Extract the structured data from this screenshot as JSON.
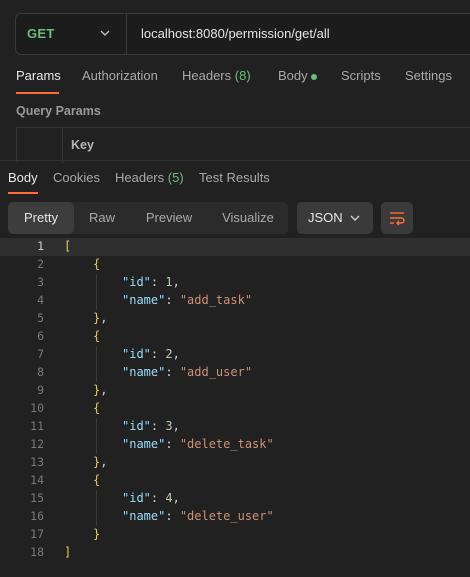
{
  "request": {
    "method": "GET",
    "url": "localhost:8080/permission/get/all"
  },
  "request_tabs": [
    {
      "label": "Params"
    },
    {
      "label": "Authorization"
    },
    {
      "label": "Headers",
      "count": "(8)"
    },
    {
      "label": "Body"
    },
    {
      "label": "Scripts"
    },
    {
      "label": "Settings"
    }
  ],
  "query_params": {
    "title": "Query Params",
    "key_header": "Key"
  },
  "response_tabs": [
    {
      "label": "Body"
    },
    {
      "label": "Cookies"
    },
    {
      "label": "Headers",
      "count": "(5)"
    },
    {
      "label": "Test Results"
    }
  ],
  "view_modes": [
    "Pretty",
    "Raw",
    "Preview",
    "Visualize"
  ],
  "format": "JSON",
  "code_lines": [
    {
      "n": "1",
      "indent": 0,
      "tokens": [
        [
          "b",
          "["
        ]
      ]
    },
    {
      "n": "2",
      "indent": 1,
      "tokens": [
        [
          "b",
          "{"
        ]
      ]
    },
    {
      "n": "3",
      "indent": 2,
      "tokens": [
        [
          "k",
          "\"id\""
        ],
        [
          "p",
          ": "
        ],
        [
          "n",
          "1"
        ],
        [
          "p",
          ","
        ]
      ]
    },
    {
      "n": "4",
      "indent": 2,
      "tokens": [
        [
          "k",
          "\"name\""
        ],
        [
          "p",
          ": "
        ],
        [
          "s",
          "\"add_task\""
        ]
      ]
    },
    {
      "n": "5",
      "indent": 1,
      "tokens": [
        [
          "b",
          "}"
        ],
        [
          "p",
          ","
        ]
      ]
    },
    {
      "n": "6",
      "indent": 1,
      "tokens": [
        [
          "b",
          "{"
        ]
      ]
    },
    {
      "n": "7",
      "indent": 2,
      "tokens": [
        [
          "k",
          "\"id\""
        ],
        [
          "p",
          ": "
        ],
        [
          "n",
          "2"
        ],
        [
          "p",
          ","
        ]
      ]
    },
    {
      "n": "8",
      "indent": 2,
      "tokens": [
        [
          "k",
          "\"name\""
        ],
        [
          "p",
          ": "
        ],
        [
          "s",
          "\"add_user\""
        ]
      ]
    },
    {
      "n": "9",
      "indent": 1,
      "tokens": [
        [
          "b",
          "}"
        ],
        [
          "p",
          ","
        ]
      ]
    },
    {
      "n": "10",
      "indent": 1,
      "tokens": [
        [
          "b",
          "{"
        ]
      ]
    },
    {
      "n": "11",
      "indent": 2,
      "tokens": [
        [
          "k",
          "\"id\""
        ],
        [
          "p",
          ": "
        ],
        [
          "n",
          "3"
        ],
        [
          "p",
          ","
        ]
      ]
    },
    {
      "n": "12",
      "indent": 2,
      "tokens": [
        [
          "k",
          "\"name\""
        ],
        [
          "p",
          ": "
        ],
        [
          "s",
          "\"delete_task\""
        ]
      ]
    },
    {
      "n": "13",
      "indent": 1,
      "tokens": [
        [
          "b",
          "}"
        ],
        [
          "p",
          ","
        ]
      ]
    },
    {
      "n": "14",
      "indent": 1,
      "tokens": [
        [
          "b",
          "{"
        ]
      ]
    },
    {
      "n": "15",
      "indent": 2,
      "tokens": [
        [
          "k",
          "\"id\""
        ],
        [
          "p",
          ": "
        ],
        [
          "n",
          "4"
        ],
        [
          "p",
          ","
        ]
      ]
    },
    {
      "n": "16",
      "indent": 2,
      "tokens": [
        [
          "k",
          "\"name\""
        ],
        [
          "p",
          ": "
        ],
        [
          "s",
          "\"delete_user\""
        ]
      ]
    },
    {
      "n": "17",
      "indent": 1,
      "tokens": [
        [
          "b",
          "}"
        ]
      ]
    },
    {
      "n": "18",
      "indent": 0,
      "tokens": [
        [
          "b",
          "]"
        ]
      ]
    }
  ],
  "colors": {
    "method_get": "#6bbd7a",
    "accent": "#ff6c37",
    "json_key": "#9cdcfe",
    "json_string": "#ce9178",
    "json_number": "#b5cea8",
    "json_bracket": "#e8c96a"
  },
  "icons": [
    "chevron-down-icon",
    "wrap-lines-icon"
  ]
}
